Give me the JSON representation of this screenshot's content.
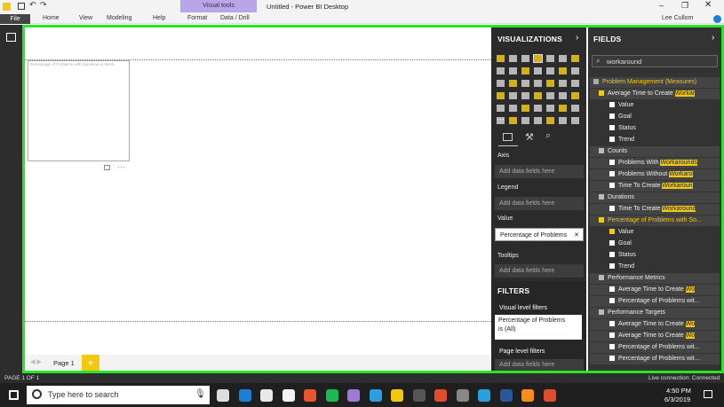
{
  "window": {
    "title": "Untitled - Power BI Desktop",
    "user": "Lee Cullom",
    "contextual_tab": "Visual tools"
  },
  "ribbon": {
    "tabs": [
      "File",
      "Home",
      "View",
      "Modeling",
      "Help",
      "Format",
      "Data / Drill"
    ]
  },
  "canvas": {
    "visual_title": "Percentage of Problems with Solutions or Work..."
  },
  "pages": {
    "tabs": [
      "Page 1"
    ],
    "add": "+"
  },
  "status": {
    "page": "PAGE 1 OF 1",
    "connection": "Live connection: Connected"
  },
  "viz_pane": {
    "title": "VISUALIZATIONS",
    "wells": [
      {
        "label": "Axis",
        "placeholder": "Add data fields here"
      },
      {
        "label": "Legend",
        "placeholder": "Add data fields here"
      },
      {
        "label": "Value",
        "value": "Percentage of Problems"
      },
      {
        "label": "Tooltips",
        "placeholder": "Add data fields here"
      }
    ],
    "filters_title": "FILTERS",
    "visual_filters": "Visual level filters",
    "filter_card_line1": "Percentage of Problems",
    "filter_card_line2": "is (All)",
    "page_filters": "Page level filters",
    "page_filters_placeholder": "Add data fields here"
  },
  "fields_pane": {
    "title": "FIELDS",
    "search_value": "workaround",
    "rows": [
      {
        "text": "Problem Management (Measures)",
        "kind": "table"
      },
      {
        "text": "Average Time to Create ",
        "hl": "Workar",
        "kind": "kpi"
      },
      {
        "text": "Value",
        "kind": "sub"
      },
      {
        "text": "Goal",
        "kind": "sub"
      },
      {
        "text": "Status",
        "kind": "sub"
      },
      {
        "text": "Trend",
        "kind": "sub"
      },
      {
        "text": "Counts",
        "kind": "folder"
      },
      {
        "text": "Problems With ",
        "hl": "Workarounds",
        "kind": "field"
      },
      {
        "text": "Problems Without ",
        "hl": "Workaro",
        "kind": "field"
      },
      {
        "text": "Time To Create ",
        "hl": "Workaroun",
        "kind": "field"
      },
      {
        "text": "Durations",
        "kind": "folder"
      },
      {
        "text": "Time To Create ",
        "hl": "Workaround",
        "kind": "field"
      },
      {
        "text": "Percentage of Problems with So...",
        "kind": "kpi-sel"
      },
      {
        "text": "Value",
        "kind": "sub-checked"
      },
      {
        "text": "Goal",
        "kind": "sub"
      },
      {
        "text": "Status",
        "kind": "sub"
      },
      {
        "text": "Trend",
        "kind": "sub"
      },
      {
        "text": "Performance Metrics",
        "kind": "folder"
      },
      {
        "text": "Average Time to Create ",
        "hl": "Wo",
        "kind": "field"
      },
      {
        "text": "Percentage of Problems wit...",
        "kind": "field"
      },
      {
        "text": "Performance Targets",
        "kind": "folder"
      },
      {
        "text": "Average Time to Create ",
        "hl": "Wo",
        "kind": "field"
      },
      {
        "text": "Average Time to Create ",
        "hl": "Wo",
        "kind": "field"
      },
      {
        "text": "Percentage of Problems wit...",
        "kind": "field"
      },
      {
        "text": "Percentage of Problems wit...",
        "kind": "field"
      }
    ]
  },
  "taskbar": {
    "search_placeholder": "Type here to search",
    "time": "4:50 PM",
    "date": "6/3/2019"
  },
  "colors": {
    "accent_yellow": "#f2c811",
    "frame_green": "#27e627",
    "contextual_purple": "#b9a6e8"
  }
}
